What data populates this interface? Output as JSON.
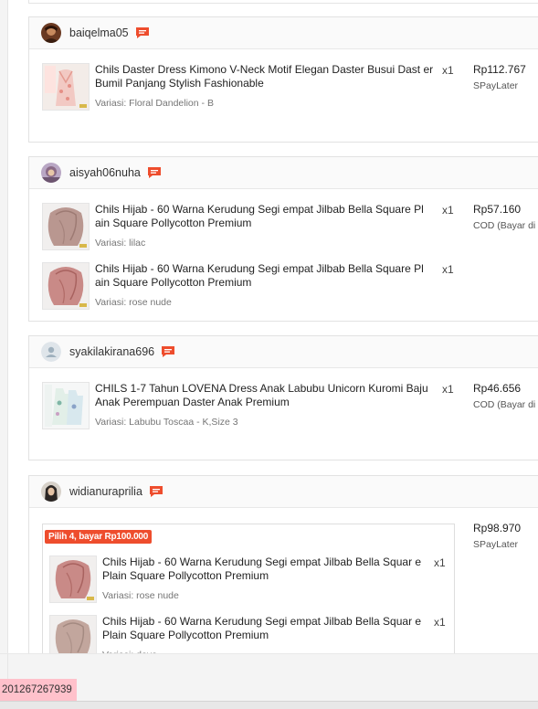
{
  "orders": [
    {
      "username": "baiqelma05",
      "items": [
        {
          "name": "Chils Daster Dress Kimono V-Neck Motif Elegan Daster Busui Dast er Bumil Panjang Stylish Fashionable",
          "qty": "x1",
          "variant": "Variasi: Floral Dandelion - B"
        }
      ],
      "price": "Rp112.767",
      "payment": "SPayLater"
    },
    {
      "username": "aisyah06nuha",
      "items": [
        {
          "name": "Chils Hijab - 60 Warna Kerudung Segi empat Jilbab Bella Square Pl ain Square Pollycotton Premium",
          "qty": "x1",
          "variant": "Variasi: lilac"
        },
        {
          "name": "Chils Hijab - 60 Warna Kerudung Segi empat Jilbab Bella Square Pl ain Square Pollycotton Premium",
          "qty": "x1",
          "variant": "Variasi: rose nude"
        }
      ],
      "price": "Rp57.160",
      "payment": "COD (Bayar di T"
    },
    {
      "username": "syakilakirana696",
      "items": [
        {
          "name": "CHILS 1-7 Tahun LOVENA Dress Anak Labubu Unicorn Kuromi Baju Anak Perempuan Daster Anak Premium",
          "qty": "x1",
          "variant": "Variasi: Labubu Toscaa - K,Size 3"
        }
      ],
      "price": "Rp46.656",
      "payment": "COD (Bayar di T"
    },
    {
      "username": "widianuraprilia",
      "promo": "Pilih 4, bayar Rp100.000",
      "items": [
        {
          "name": "Chils Hijab - 60 Warna Kerudung Segi empat Jilbab Bella Squar e Plain Square Pollycotton Premium",
          "qty": "x1",
          "variant": "Variasi: rose nude"
        },
        {
          "name": "Chils Hijab - 60 Warna Kerudung Segi empat Jilbab Bella Squar e Plain Square Pollycotton Premium",
          "qty": "x1",
          "variant": "Variasi: dove"
        }
      ],
      "price": "Rp98.970",
      "payment": "SPayLater"
    }
  ],
  "footer": {
    "order_id": "201267267939"
  },
  "colors": {
    "accent": "#ee4d2d",
    "order_id_bg": "#ffc1cb"
  }
}
